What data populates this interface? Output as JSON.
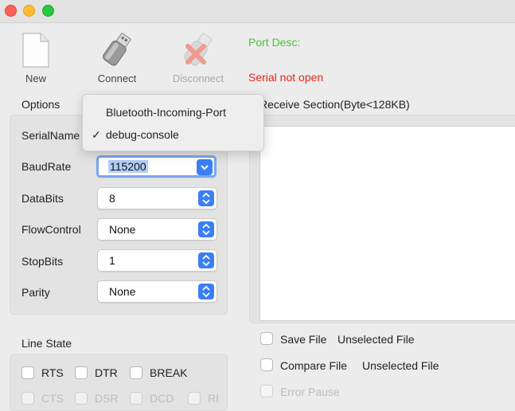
{
  "toolbar": {
    "new_label": "New",
    "connect_label": "Connect",
    "disconnect_label": "Disconnect",
    "port_desc": "Port Desc:",
    "serial_status": "Serial not open"
  },
  "options": {
    "title": "Options",
    "rows": [
      {
        "label": "SerialName",
        "value": ""
      },
      {
        "label": "BaudRate",
        "value": "115200"
      },
      {
        "label": "DataBits",
        "value": "8"
      },
      {
        "label": "FlowControl",
        "value": "None"
      },
      {
        "label": "StopBits",
        "value": "1"
      },
      {
        "label": "Parity",
        "value": "None"
      }
    ]
  },
  "serial_menu": {
    "items": [
      "Bluetooth-Incoming-Port",
      "debug-console"
    ],
    "checked_index": 1,
    "check_glyph": "✓"
  },
  "receive": {
    "title": "Receive Section(Byte<128KB)",
    "save_file_label": "Save File",
    "save_file_value": "Unselected File",
    "compare_file_label": "Compare File",
    "compare_file_value": "Unselected File",
    "error_pause_label": "Error Pause"
  },
  "line_state": {
    "title": "Line State",
    "row1": [
      "RTS",
      "DTR",
      "BREAK"
    ],
    "row2": [
      "CTS",
      "DSR",
      "DCD",
      "RI"
    ]
  },
  "colors": {
    "accent": "#3b7ff6",
    "status_ok": "#4fbf3a",
    "status_error": "#e0261c"
  }
}
